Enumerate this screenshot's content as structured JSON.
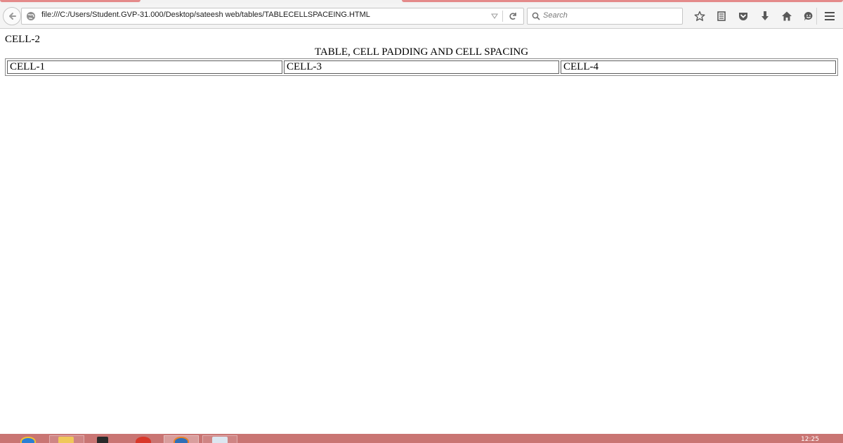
{
  "browser": {
    "url": "file:///C:/Users/Student.GVP-31.000/Desktop/sateesh web/tables/TABLECELLSPACEING.HTML",
    "search_placeholder": "Search",
    "icons": [
      "back-arrow-icon",
      "globe-icon",
      "dropmarker-icon",
      "reload-icon",
      "search-icon",
      "bookmark-star-icon",
      "reading-list-icon",
      "pocket-icon",
      "download-icon",
      "home-icon",
      "hello-chat-icon",
      "menu-icon"
    ]
  },
  "page": {
    "loose_cell": "CELL-2",
    "table_caption": "TABLE, CELL PADDING AND CELL SPACING",
    "table_cells": [
      "CELL-1",
      "CELL-3",
      "CELL-4"
    ]
  },
  "taskbar": {
    "clock": "12:25",
    "accent_color": "#c97573",
    "apps": [
      "internet-explorer-icon",
      "file-explorer-icon",
      "terminal-icon",
      "chrome-icon",
      "firefox-icon",
      "notepad-icon"
    ]
  }
}
